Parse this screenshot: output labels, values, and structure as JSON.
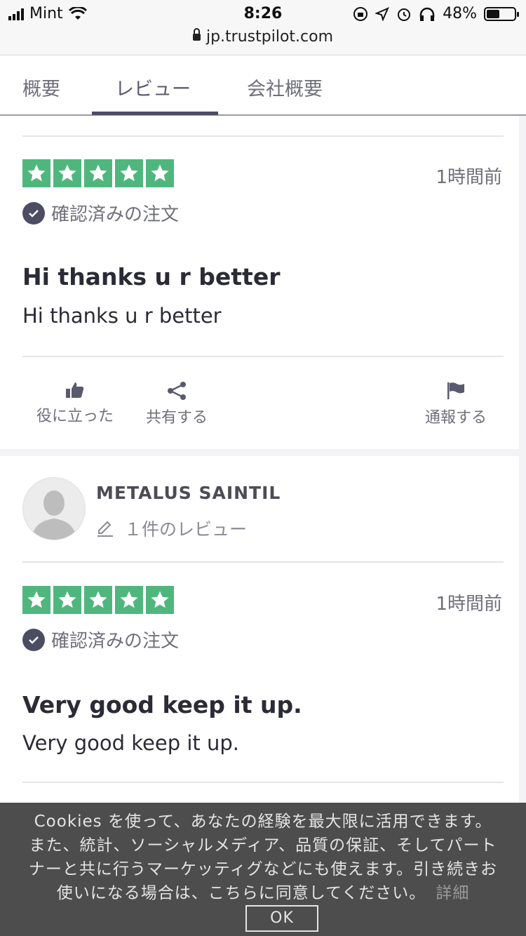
{
  "status_bar": {
    "carrier": "Mint",
    "time": "8:26",
    "battery": "48%",
    "battery_level": 0.48
  },
  "url_bar": {
    "domain": "jp.trustpilot.com"
  },
  "tabs": [
    {
      "label": "概要"
    },
    {
      "label": "レビュー",
      "active": true
    },
    {
      "label": "会社概要"
    }
  ],
  "reviews": [
    {
      "rating": 5,
      "time": "1時間前",
      "verified_label": "確認済みの注文",
      "title": "Hi thanks u r better",
      "body": "Hi thanks u r better",
      "actions": {
        "useful": "役に立った",
        "share": "共有する",
        "report": "通報する"
      }
    },
    {
      "reviewer_name": "METALUS SAINTIL",
      "reviewer_count": "１件のレビュー",
      "rating": 5,
      "time": "1時間前",
      "verified_label": "確認済みの注文",
      "title": "Very good keep it up.",
      "body": "Very good keep it up."
    }
  ],
  "cookie_banner": {
    "text": "Cookies を使って、あなたの経験を最大限に活用できます。また、統計、ソーシャルメディア、品質の保証、そしてパートナーと共に行うマーケッティグなどにも使えます。引き続きお使いになる場合は、こちらに同意してください。",
    "more_label": "詳細",
    "ok_label": "OK"
  },
  "colors": {
    "star_green": "#4fb77d",
    "accent_dark": "#4c4c63",
    "cookie_bg": "#464646"
  }
}
